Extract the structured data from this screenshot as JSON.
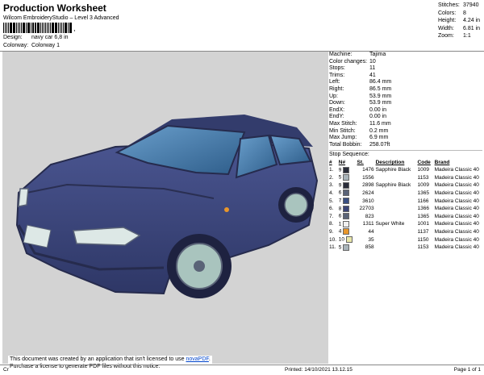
{
  "header": {
    "title": "Production Worksheet",
    "subtitle": "Wilcom EmbroideryStudio – Level 3 Advanced",
    "barcode_sep": ","
  },
  "design": {
    "design_label": "Design:",
    "design_value": "navy car 6,8 in",
    "colorway_label": "Colorway:",
    "colorway_value": "Colorway 1"
  },
  "stats": [
    {
      "k": "Stitches:",
      "v": "37940"
    },
    {
      "k": "Colors:",
      "v": "8"
    },
    {
      "k": "Height:",
      "v": "4.24 in"
    },
    {
      "k": "Width:",
      "v": "6.81 in"
    },
    {
      "k": "Zoom:",
      "v": "1:1"
    }
  ],
  "machine": [
    {
      "k": "Machine:",
      "v": "Tajima"
    },
    {
      "k": "Color changes:",
      "v": "10"
    },
    {
      "k": "Stops:",
      "v": "11"
    },
    {
      "k": "Trims:",
      "v": "41"
    },
    {
      "k": "Left:",
      "v": "86.4 mm"
    },
    {
      "k": "Right:",
      "v": "86.5 mm"
    },
    {
      "k": "Up:",
      "v": "53.9 mm"
    },
    {
      "k": "Down:",
      "v": "53.9 mm"
    },
    {
      "k": "EndX:",
      "v": "0.00 in"
    },
    {
      "k": "EndY:",
      "v": "0.00 in"
    },
    {
      "k": "Max Stitch:",
      "v": "11.6 mm"
    },
    {
      "k": "Min Stitch:",
      "v": "0.2 mm"
    },
    {
      "k": "Max Jump:",
      "v": "6.9 mm"
    },
    {
      "k": "Total Bobbin:",
      "v": "258.07ft"
    }
  ],
  "stop_sequence": {
    "title": "Stop Sequence:",
    "columns": [
      "#",
      "N#",
      "St.",
      "Description",
      "Code",
      "Brand"
    ],
    "rows": [
      {
        "n": "1.",
        "c": "9",
        "color": "#2a2d3a",
        "st": "1476",
        "desc": "Sapphire Black",
        "code": "1009",
        "brand": "Madeira Classic 40"
      },
      {
        "n": "2.",
        "c": "5",
        "color": "#a9b4ba",
        "st": "1556",
        "desc": "",
        "code": "1153",
        "brand": "Madeira Classic 40"
      },
      {
        "n": "3.",
        "c": "9",
        "color": "#2a2d3a",
        "st": "2898",
        "desc": "Sapphire Black",
        "code": "1009",
        "brand": "Madeira Classic 40"
      },
      {
        "n": "4.",
        "c": "6",
        "color": "#5a6377",
        "st": "2624",
        "desc": "",
        "code": "1365",
        "brand": "Madeira Classic 40"
      },
      {
        "n": "5.",
        "c": "7",
        "color": "#3a4f82",
        "st": "3610",
        "desc": "",
        "code": "1166",
        "brand": "Madeira Classic 40"
      },
      {
        "n": "6.",
        "c": "8",
        "color": "#3b4577",
        "st": "22703",
        "desc": "",
        "code": "1366",
        "brand": "Madeira Classic 40"
      },
      {
        "n": "7.",
        "c": "6",
        "color": "#5a6377",
        "st": "823",
        "desc": "",
        "code": "1365",
        "brand": "Madeira Classic 40"
      },
      {
        "n": "8.",
        "c": "1",
        "color": "#f0f0f0",
        "st": "1311",
        "desc": "Super White",
        "code": "1001",
        "brand": "Madeira Classic 40"
      },
      {
        "n": "9.",
        "c": "4",
        "color": "#e8962a",
        "st": "44",
        "desc": "",
        "code": "1137",
        "brand": "Madeira Classic 40"
      },
      {
        "n": "10.",
        "c": "10",
        "color": "#e8e6a8",
        "st": "35",
        "desc": "",
        "code": "1150",
        "brand": "Madeira Classic 40"
      },
      {
        "n": "11.",
        "c": "5",
        "color": "#a9b4ba",
        "st": "858",
        "desc": "",
        "code": "1153",
        "brand": "Madeira Classic 40"
      }
    ]
  },
  "notice": {
    "line1_pre": "This document was created by an application that isn't licensed to use ",
    "link": "novaPDF",
    "line1_post": ".",
    "line2": "Purchase a license to generate PDF files without this notice."
  },
  "footer": {
    "left": "Cr",
    "printed": "Printed: 14/10/2021 13.12.15",
    "page": "Page 1 of 1"
  },
  "colors": {
    "car_body": "#3b4577",
    "car_dark": "#2a2f52",
    "glass": "#4a7fb0",
    "wheel": "#a9c4be",
    "background": "#d3d3d3"
  }
}
